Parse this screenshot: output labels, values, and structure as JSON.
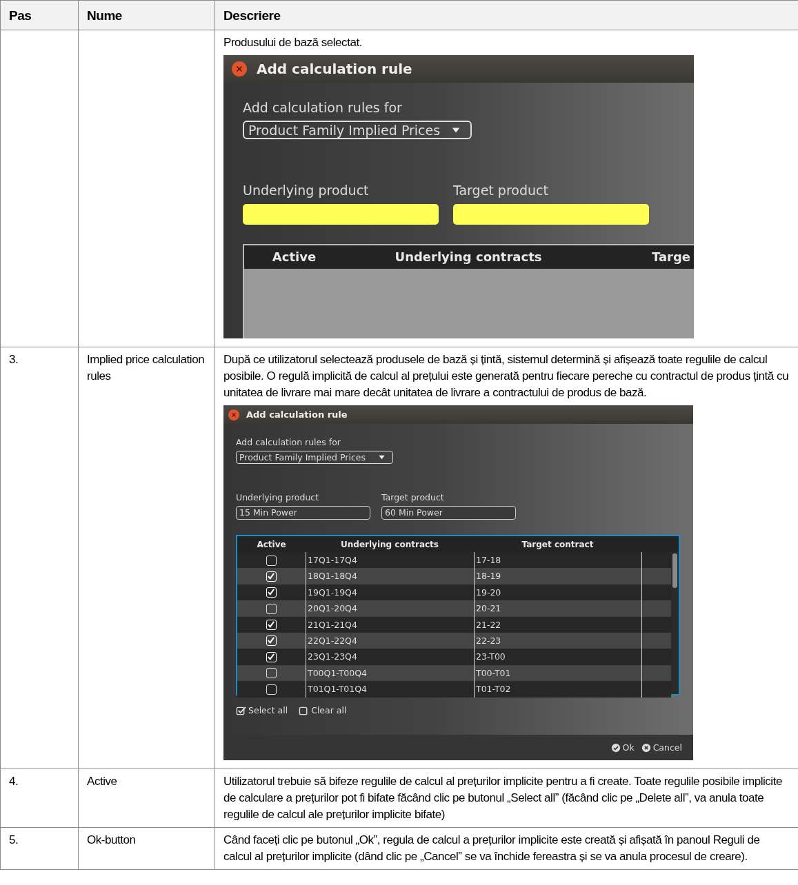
{
  "table": {
    "columns": [
      "Pas",
      "Nume",
      "Descriere"
    ],
    "rows": [
      {
        "description": "Produsului de bază selectat.",
        "dialog": {
          "title": "Add calculation rule",
          "rules_label": "Add calculation rules for",
          "rules_value": "Product Family Implied Prices",
          "underlying_field": {
            "label": "Underlying product",
            "highlighted": true
          },
          "target_field": {
            "label": "Target product",
            "highlighted": true
          },
          "grid": {
            "columns": [
              "Active",
              "Underlying contracts",
              "Targe"
            ]
          }
        }
      },
      {
        "step": "3.",
        "name": "Implied price calculation rules",
        "description": "După ce utilizatorul selectează produsele de bază și țintă, sistemul determină și afișează toate regulile de calcul posibile. O regulă implicită de calcul al prețului este generată pentru fiecare pereche cu contractul de produs țintă cu unitatea de livrare mai mare decât unitatea de livrare a contractului de produs de bază.",
        "dialog": {
          "title": "Add calculation rule",
          "rules_label": "Add calculation rules for",
          "rules_value": "Product Family Implied Prices",
          "underlying_field": {
            "label": "Underlying product",
            "value": "15 Min Power",
            "highlighted": false
          },
          "target_field": {
            "label": "Target product",
            "value": "60 Min Power",
            "highlighted": false
          },
          "grid": {
            "columns": [
              "Active",
              "Underlying contracts",
              "Target contract"
            ],
            "rows": [
              {
                "active": false,
                "underlying": "17Q1-17Q4",
                "target": "17-18"
              },
              {
                "active": true,
                "underlying": "18Q1-18Q4",
                "target": "18-19"
              },
              {
                "active": true,
                "underlying": "19Q1-19Q4",
                "target": "19-20"
              },
              {
                "active": false,
                "underlying": "20Q1-20Q4",
                "target": "20-21"
              },
              {
                "active": true,
                "underlying": "21Q1-21Q4",
                "target": "21-22"
              },
              {
                "active": true,
                "underlying": "22Q1-22Q4",
                "target": "22-23"
              },
              {
                "active": true,
                "underlying": "23Q1-23Q4",
                "target": "23-T00"
              },
              {
                "active": false,
                "underlying": "T00Q1-T00Q4",
                "target": "T00-T01"
              },
              {
                "active": false,
                "underlying": "T01Q1-T01Q4",
                "target": "T01-T02"
              }
            ]
          },
          "bulk": [
            {
              "label": "Select all",
              "checked": true
            },
            {
              "label": "Clear all",
              "checked": false
            }
          ],
          "buttons": [
            {
              "label": "Ok",
              "kind": "ok"
            },
            {
              "label": "Cancel",
              "kind": "cancel"
            }
          ]
        }
      },
      {
        "step": "4.",
        "name": "Active",
        "description": "Utilizatorul trebuie să bifeze regulile de calcul al prețurilor implicite pentru a fi create. Toate regulile posibile implicite de calculare a prețurilor pot fi bifate făcând clic pe butonul „Select all” (făcând clic pe „Delete all”, va anula toate regulile de calcul ale prețurilor implicite bifate)"
      },
      {
        "step": "5.",
        "name": "Ok-button",
        "description": "Când faceți clic pe butonul „Ok”, regula de calcul a prețurilor implicite este creată și afișată în panoul Reguli de calcul al prețurilor implicite (dând clic pe „Cancel” se va închide fereastra și se va anula procesul de creare)."
      }
    ]
  }
}
